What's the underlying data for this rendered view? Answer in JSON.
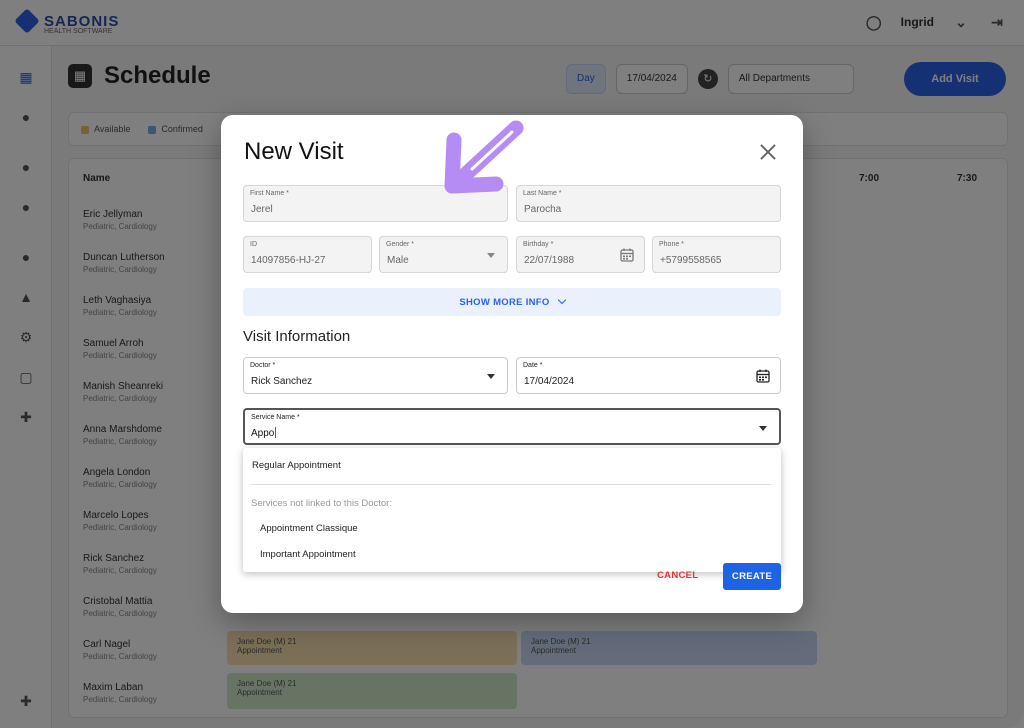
{
  "app": {
    "logo_text": "SABONIS",
    "logo_sub": "HEALTH SOFTWARE",
    "user": "Ingrid"
  },
  "page": {
    "title": "Schedule",
    "add_visit": "Add Visit"
  },
  "header_controls": {
    "view": "Day",
    "date": "17/04/2024",
    "department": "All Departments"
  },
  "legend": [
    "Available",
    "Confirmed"
  ],
  "table": {
    "name_header": "Name",
    "time_headers": [
      "7:00",
      "7:30"
    ],
    "doctors": [
      {
        "name": "Eric Jellyman",
        "sub": "Pediatric, Cardiology"
      },
      {
        "name": "Duncan Lutherson",
        "sub": "Pediatric, Cardiology"
      },
      {
        "name": "Leth Vaghasiya",
        "sub": "Pediatric, Cardiology"
      },
      {
        "name": "Samuel Arroh",
        "sub": "Pediatric, Cardiology"
      },
      {
        "name": "Manish Sheanreki",
        "sub": "Pediatric, Cardiology"
      },
      {
        "name": "Anna Marshdome",
        "sub": "Pediatric, Cardiology"
      },
      {
        "name": "Angela London",
        "sub": "Pediatric, Cardiology"
      },
      {
        "name": "Marcelo Lopes",
        "sub": "Pediatric, Cardiology"
      },
      {
        "name": "Rick Sanchez",
        "sub": "Pediatric, Cardiology"
      },
      {
        "name": "Cristobal Mattia",
        "sub": "Pediatric, Cardiology"
      },
      {
        "name": "Carl Nagel",
        "sub": "Pediatric, Cardiology"
      },
      {
        "name": "Maxim Laban",
        "sub": "Pediatric, Cardiology"
      }
    ],
    "slots": [
      {
        "label": "Jane Doe (M) 21",
        "sub": "Appointment"
      },
      {
        "label": "Jane Doe (M) 21",
        "sub": "Appointment"
      },
      {
        "label": "Jane Doe (M) 21",
        "sub": "Appointment"
      }
    ]
  },
  "modal": {
    "title": "New Visit",
    "fields": {
      "first_name": {
        "label": "First Name *",
        "value": "Jerel"
      },
      "last_name": {
        "label": "Last Name *",
        "value": "Parocha"
      },
      "id": {
        "label": "ID",
        "value": "14097856-HJ-27"
      },
      "gender": {
        "label": "Gender *",
        "value": "Male"
      },
      "birthday": {
        "label": "Birthday *",
        "value": "22/07/1988"
      },
      "phone": {
        "label": "Phone *",
        "value": "+5799558565"
      }
    },
    "show_more": "SHOW MORE INFO",
    "visit_section": "Visit Information",
    "visit_fields": {
      "doctor": {
        "label": "Doctor *",
        "value": "Rick Sanchez"
      },
      "date": {
        "label": "Date *",
        "value": "17/04/2024"
      },
      "service": {
        "label": "Service Name *",
        "value": "Appo"
      }
    },
    "dropdown": {
      "linked_options": [
        "Regular Appointment"
      ],
      "group_label": "Services not linked to this Doctor:",
      "unlinked_options": [
        "Appointment Classique",
        "Important Appointment"
      ]
    },
    "cancel": "CANCEL",
    "create": "CREATE"
  },
  "colors": {
    "primary": "#1e63e5",
    "cancel": "#d63a3a",
    "annotation": "#b58cf3",
    "show_more_bg": "#eaf0fc"
  }
}
